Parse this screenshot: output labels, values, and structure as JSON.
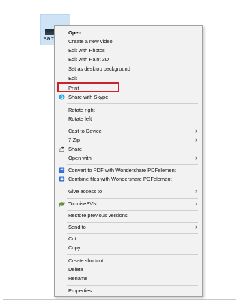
{
  "file": {
    "name": "samp",
    "icon": "video-thumbnail-icon"
  },
  "menu": {
    "items": [
      {
        "label": "Open",
        "bold": true
      },
      {
        "label": "Create a new video"
      },
      {
        "label": "Edit with Photos"
      },
      {
        "label": "Edit with Paint 3D"
      },
      {
        "label": "Set as desktop background"
      },
      {
        "label": "Edit"
      },
      {
        "label": "Print",
        "highlighted": true
      },
      {
        "label": "Share with Skype",
        "icon": "skype-icon"
      },
      {
        "label": "Rotate right"
      },
      {
        "label": "Rotate left"
      },
      {
        "label": "Cast to Device",
        "submenu": true
      },
      {
        "label": "7-Zip",
        "submenu": true
      },
      {
        "label": "Share",
        "icon": "share-icon"
      },
      {
        "label": "Open with",
        "submenu": true
      },
      {
        "label": "Convert to PDF with Wondershare PDFelement",
        "icon": "pdfelement-icon"
      },
      {
        "label": "Combine files with Wondershare PDFelement",
        "icon": "pdfelement-icon"
      },
      {
        "label": "Give access to",
        "submenu": true
      },
      {
        "label": "TortoiseSVN",
        "icon": "tortoisesvn-icon",
        "submenu": true
      },
      {
        "label": "Restore previous versions"
      },
      {
        "label": "Send to",
        "submenu": true
      },
      {
        "label": "Cut"
      },
      {
        "label": "Copy"
      },
      {
        "label": "Create shortcut"
      },
      {
        "label": "Delete"
      },
      {
        "label": "Rename"
      },
      {
        "label": "Properties"
      }
    ],
    "submenu_arrow": "›",
    "highlight_color": "#cc2229"
  }
}
